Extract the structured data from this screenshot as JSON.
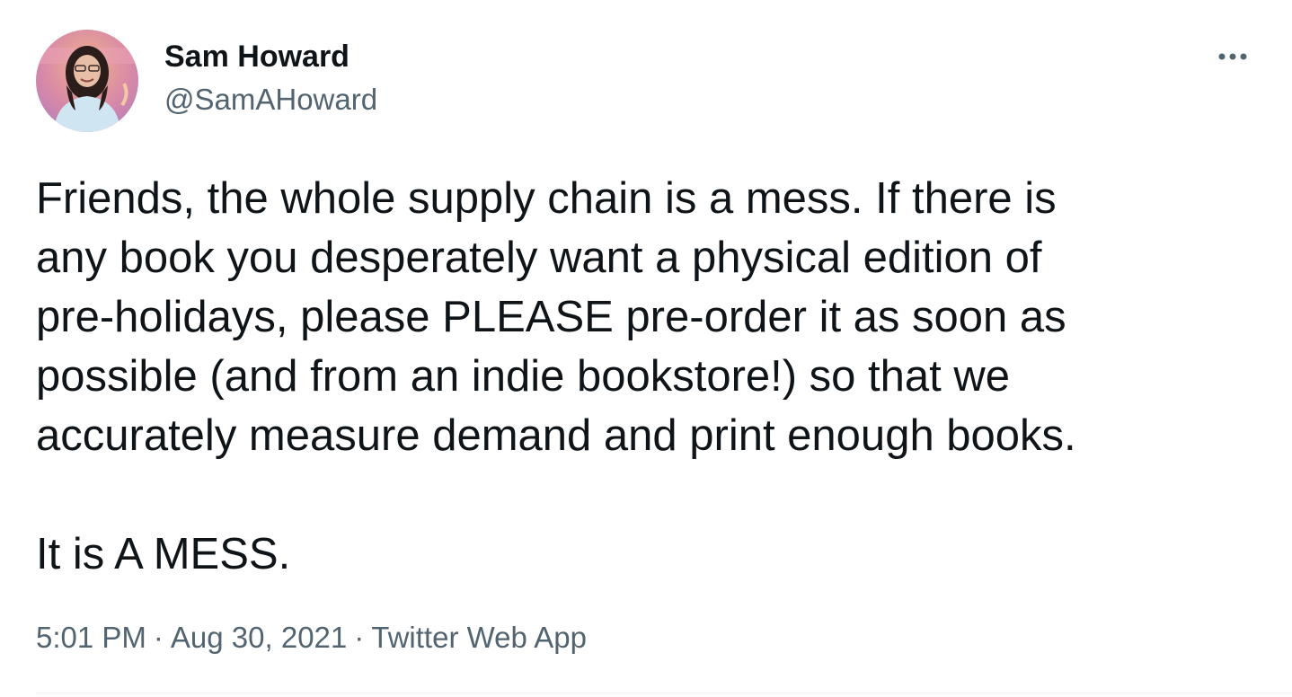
{
  "author": {
    "display_name": "Sam Howard",
    "handle": "@SamAHoward",
    "avatar_icon": "user-avatar"
  },
  "actions": {
    "more_icon": "more-horizontal-icon"
  },
  "tweet": {
    "paragraphs": [
      "Friends, the whole supply chain is a mess. If there is\nany book you desperately want a physical edition of\npre-holidays, please PLEASE pre-order it as soon as\npossible (and from an indie bookstore!) so that we\naccurately measure demand and print enough books.",
      "It is A MESS."
    ]
  },
  "meta": {
    "time": "5:01 PM",
    "separator": "·",
    "date": "Aug 30, 2021",
    "source": "Twitter Web App"
  },
  "colors": {
    "text_primary": "#0f1419",
    "text_secondary": "#536471",
    "divider": "#eff3f4"
  }
}
